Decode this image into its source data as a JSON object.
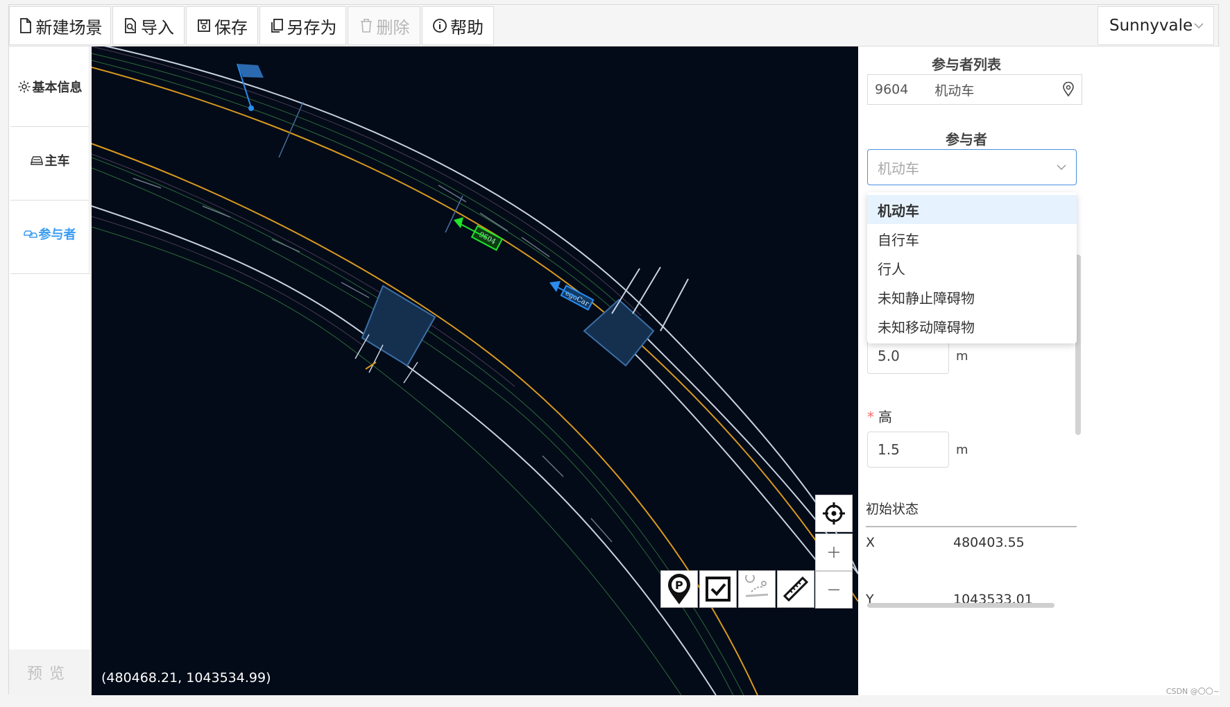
{
  "toolbar": {
    "new_scene": "新建场景",
    "import": "导入",
    "save": "保存",
    "save_as": "另存为",
    "delete": "删除",
    "help": "帮助",
    "city": "Sunnyvale"
  },
  "nav": {
    "basic_info": "基本信息",
    "main_car": "主车",
    "participants": "参与者",
    "preview": "预览"
  },
  "map": {
    "coords": "(480468.21, 1043534.99)",
    "agent_label": "9604",
    "ego_label": "egoCar"
  },
  "panel": {
    "list_title": "参与者列表",
    "list_item": {
      "id": "9604",
      "type": "机动车"
    },
    "participant_title": "参与者",
    "type_placeholder": "机动车",
    "type_options": [
      "机动车",
      "自行车",
      "行人",
      "未知静止障碍物",
      "未知移动障碍物"
    ],
    "width_value": "5.0",
    "width_unit": "m",
    "height_label": "高",
    "height_value": "1.5",
    "height_unit": "m",
    "init_state_label": "初始状态",
    "x_label": "X",
    "x_value": "480403.55",
    "y_label": "Y",
    "y_value": "1043533.01"
  },
  "footer": {
    "watermark": "CSDN @〇〇~"
  },
  "colors": {
    "accent": "#3a9cf2",
    "map_bg": "#030b18",
    "lane_yellow": "#d99a1e",
    "agent_green": "#21e52a",
    "ego_blue": "#2b8df0"
  }
}
